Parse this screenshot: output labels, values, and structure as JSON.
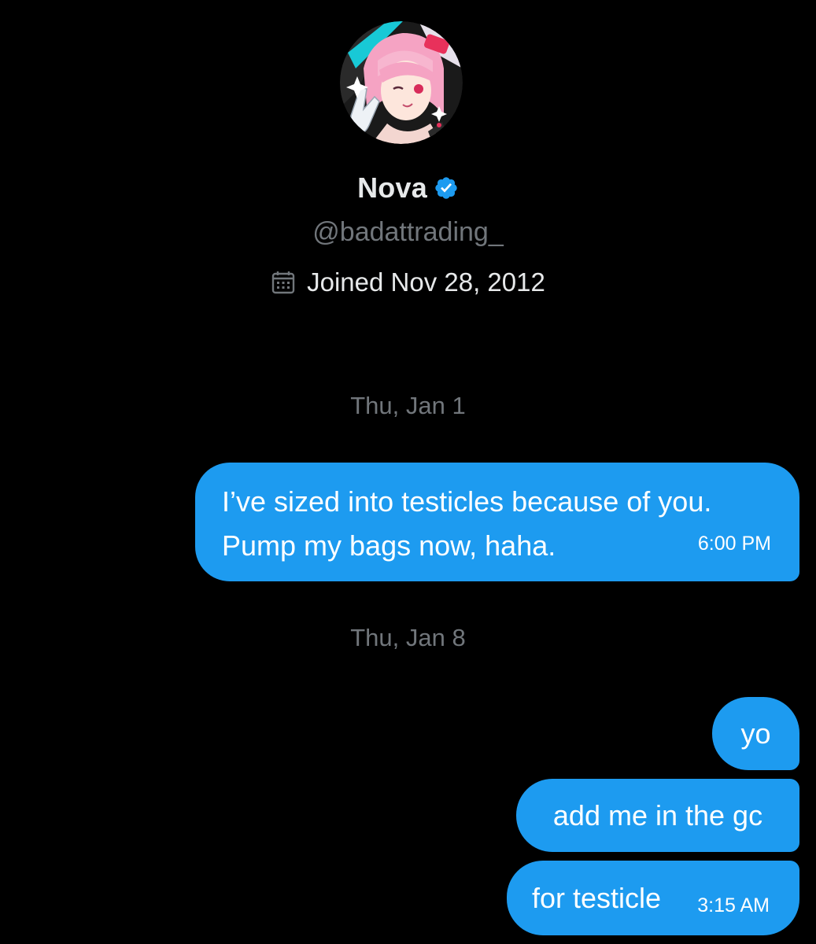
{
  "profile": {
    "name": "Nova",
    "handle": "@badattrading_",
    "joined": "Joined Nov 28, 2012",
    "avatar_icon": "anime-avatar",
    "verified_icon": "verified-badge-icon",
    "calendar_icon": "calendar-icon"
  },
  "conversation": {
    "date_1": "Thu, Jan 1",
    "date_2": "Thu, Jan 8",
    "messages": [
      {
        "lines": [
          "I’ve sized into testicles because of you.",
          "Pump my bags now, haha."
        ],
        "time": "6:00 PM"
      },
      {
        "text": "yo"
      },
      {
        "text": "add me in the gc"
      },
      {
        "text": "for testicle",
        "time": "3:15 AM"
      }
    ]
  },
  "colors": {
    "background": "#000000",
    "bubble": "#1d9bf0",
    "verified": "#1d9bf0",
    "muted_text": "#71767b",
    "primary_text": "#e7e9ea"
  }
}
